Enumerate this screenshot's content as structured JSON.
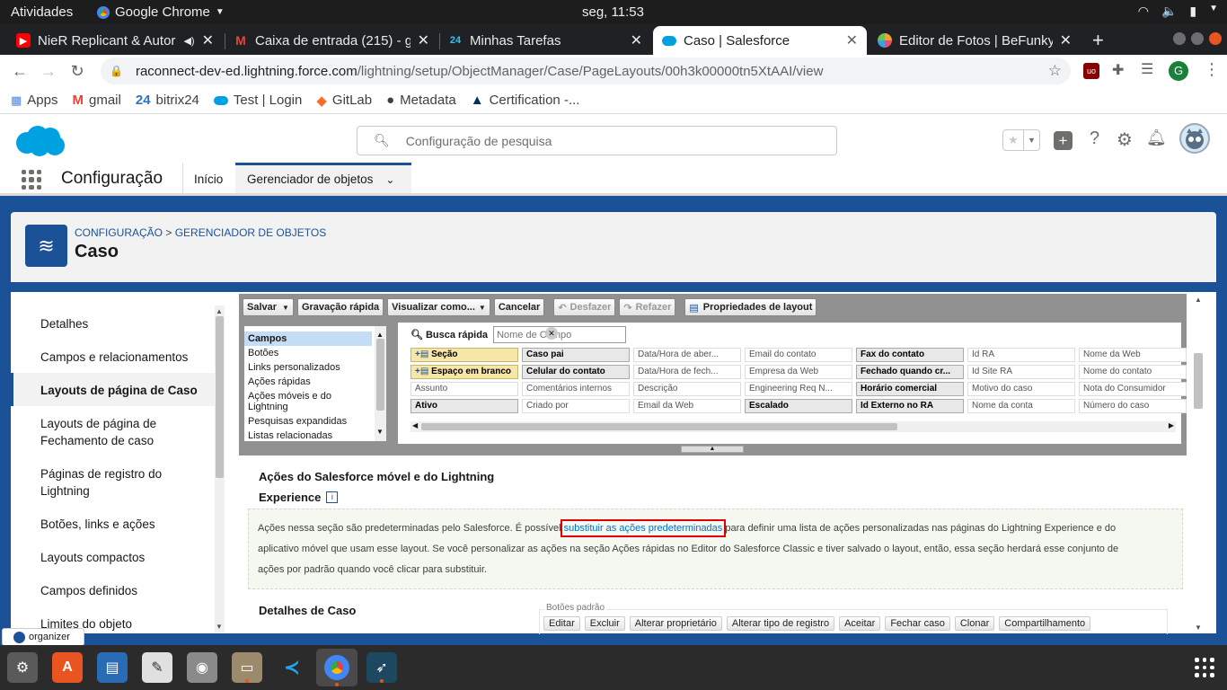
{
  "topbar": {
    "activities": "Atividades",
    "app_name": "Google Chrome",
    "clock": "seg, 11:53"
  },
  "tabs": [
    {
      "title": "NieR Replicant & Autor",
      "icon": "youtube-icon",
      "color": "#ff0000"
    },
    {
      "title": "Caixa de entrada (215) - ga",
      "icon": "gmail-icon",
      "color": "#ea4335"
    },
    {
      "title": "Minhas Tarefas",
      "icon": "bitrix-icon",
      "color": "#2fc6f6"
    },
    {
      "title": "Caso | Salesforce",
      "icon": "salesforce-icon",
      "color": "#00a1e0"
    },
    {
      "title": "Editor de Fotos | BeFunky",
      "icon": "befunky-icon",
      "color": "#f2a32a"
    }
  ],
  "address": {
    "host": "raconnect-dev-ed.lightning.force.com",
    "path": "/lightning/setup/ObjectManager/Case/PageLayouts/00h3k00000tn5XtAAI/view"
  },
  "profile_initial": "G",
  "bookmarks": [
    "Apps",
    "gmail",
    "bitrix24",
    "Test | Login",
    "GitLab",
    "Metadata",
    "Certification -..."
  ],
  "sf": {
    "search_placeholder": "Configuração de pesquisa",
    "app_name": "Configuração",
    "nav_home": "Início",
    "nav_object_manager": "Gerenciador de objetos",
    "breadcrumb_setup": "CONFIGURAÇÃO",
    "breadcrumb_sep": ">",
    "breadcrumb_om": "GERENCIADOR DE OBJETOS",
    "page_title": "Caso"
  },
  "sidebar": [
    "Detalhes",
    "Campos e relacionamentos",
    "Layouts de página de Caso",
    "Layouts de página de Fechamento de caso",
    "Páginas de registro do Lightning",
    "Botões, links e ações",
    "Layouts compactos",
    "Campos definidos",
    "Limites do objeto"
  ],
  "toolbar": {
    "save": "Salvar",
    "quick_save": "Gravação rápida",
    "preview": "Visualizar como...",
    "cancel": "Cancelar",
    "undo": "Desfazer",
    "redo": "Refazer",
    "layout_props": "Propriedades de layout"
  },
  "categories": [
    "Campos",
    "Botões",
    "Links personalizados",
    "Ações rápidas",
    "Ações móveis e do Lightning",
    "Pesquisas expandidas",
    "Listas relacionadas"
  ],
  "quick_find": {
    "label": "Busca rápida",
    "placeholder": "Nome de Campo"
  },
  "fields": [
    [
      "Seção",
      "Caso pai",
      "Data/Hora de aber...",
      "Email do contato",
      "Fax do contato",
      "Id RA",
      "Nome da Web"
    ],
    [
      "Espaço em branco",
      "Celular do contato",
      "Data/Hora de fech...",
      "Empresa da Web",
      "Fechado quando cr...",
      "Id Site RA",
      "Nome do contato"
    ],
    [
      "Assunto",
      "Comentários internos",
      "Descrição",
      "Engineering Req N...",
      "Horário comercial",
      "Motivo do caso",
      "Nota do Consumidor"
    ],
    [
      "Ativo",
      "Criado por",
      "Email da Web",
      "Escalado",
      "Id Externo no RA",
      "Nome da conta",
      "Número do caso"
    ]
  ],
  "mobile_section": {
    "title_line1": "Ações do Salesforce móvel e do Lightning",
    "title_line2": "Experience",
    "text_before": "Ações nessa seção são predeterminadas pelo Salesforce. É possível ",
    "link": "substituir as ações predeterminadas",
    "text_after": " para definir uma lista de ações personalizadas nas páginas do Lightning Experience e do",
    "line2": "aplicativo móvel que usam esse layout. Se você personalizar as ações na seção Ações rápidas no Editor do Salesforce Classic e tiver salvado o layout, então, essa seção herdará esse conjunto de",
    "line3": "ações por padrão quando você clicar para substituir."
  },
  "details": {
    "title": "Detalhes de Caso",
    "std_buttons_label": "Botões padrão",
    "buttons": [
      "Editar",
      "Excluir",
      "Alterar proprietário",
      "Alterar tipo de registro",
      "Aceitar",
      "Fechar caso",
      "Clonar",
      "Compartilhamento"
    ]
  },
  "organizer": "organizer",
  "colors": {
    "sf_blue": "#1b5297",
    "link": "#0070d2",
    "highlight_red": "#e00000"
  }
}
